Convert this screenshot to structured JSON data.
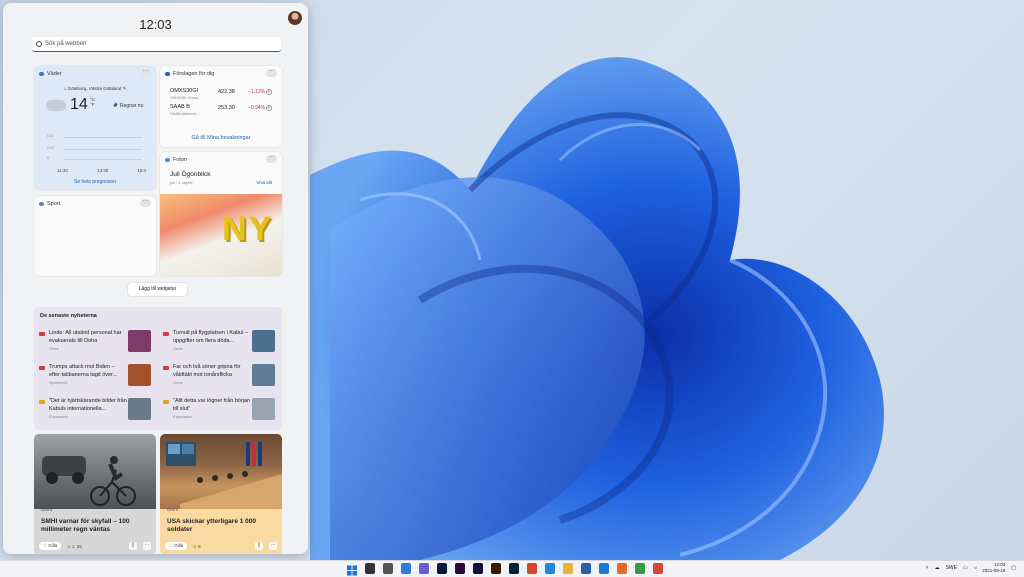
{
  "panel": {
    "time": "12:03",
    "search_placeholder": "Sök på webben"
  },
  "weather": {
    "title": "Väder",
    "location": "Göteborg, Västra Götaland",
    "temp": "14",
    "unit_c": "°C",
    "unit_f": "°F",
    "condition": "Regnar nu",
    "chart_labels": [
      "0.04",
      "0.02",
      "0"
    ],
    "times": [
      "11:30",
      "13:30",
      "15:3"
    ],
    "link": "Se hela prognosen"
  },
  "stocks": {
    "title": "Förslagen för dig",
    "rows": [
      {
        "name": "OMXS30GI",
        "sub": "OMXS30 Gross...",
        "price": "422.38",
        "change": "−1.12%"
      },
      {
        "name": "SAAB B",
        "sub": "SAAB Aktiebol...",
        "price": "253.30",
        "change": "−0.94%"
      }
    ],
    "link": "Gå till Mina bevakningar"
  },
  "photos": {
    "title": "Foton",
    "album": "Juli Ögonblick",
    "sub": "juli · 1 objekt",
    "view_all": "Visa allt",
    "image_text": "NY"
  },
  "sport": {
    "title": "Sport"
  },
  "add_widget": "Lägg till widgetar",
  "news": {
    "title": "De senaste nyheterna",
    "items": [
      {
        "text": "Linde: All utsänd personal har evakuerats till Doha",
        "source": "Omni",
        "fav": "#d23c3c",
        "img": "#7d3a6a"
      },
      {
        "text": "Tumult på flygplatsen i Kabul – uppgifter om flera döda...",
        "source": "Omni",
        "fav": "#d23c3c",
        "img": "#4b6f8f"
      },
      {
        "text": "Trumps attack mot Biden – efter talibanerna tagit över...",
        "source": "Nyheter24",
        "fav": "#d23c3c",
        "img": "#a3502f"
      },
      {
        "text": "Far och två söner gripna för våldtäkt mot tonårsflicka",
        "source": "Omni",
        "fav": "#d23c3c",
        "img": "#5f7b95"
      },
      {
        "text": "\"Det är hjärtskärande bilder från Kabuls internationella...",
        "source": "Expressen",
        "fav": "#e3a21a",
        "img": "#6a7a89"
      },
      {
        "text": "\"Allt detta var lögner från början till slut\"",
        "source": "Expressen",
        "fav": "#e3a21a",
        "img": "#9aa4b1"
      }
    ]
  },
  "cards": [
    {
      "source": "Omni",
      "title": "SMHI varnar för skyfall – 100 millimeter regn väntas",
      "like": "Gilla",
      "count": "25",
      "bg": "#d7d7d7"
    },
    {
      "source": "Omni",
      "title": "USA skickar ytterligare 1 000 soldater",
      "like": "Gilla",
      "count": "8",
      "bg": "#fbd9a3"
    }
  ],
  "tray": {
    "lang": "SWE",
    "time": "12:03",
    "date": "2021-08-16"
  },
  "colors": {
    "accent": "#2b61b4",
    "negative": "#c4314b",
    "bloom": "#1a5bd6"
  },
  "icons": [
    "start-icon",
    "search-icon",
    "task-view-icon",
    "widgets-icon",
    "chat-icon",
    "photoshop-icon",
    "premiere-icon",
    "after-effects-icon",
    "illustrator-icon",
    "lightroom-icon",
    "office-icon",
    "edge-icon",
    "file-explorer-icon",
    "store-icon",
    "mail-icon",
    "firefox-icon",
    "maps-icon",
    "chrome-icon"
  ]
}
